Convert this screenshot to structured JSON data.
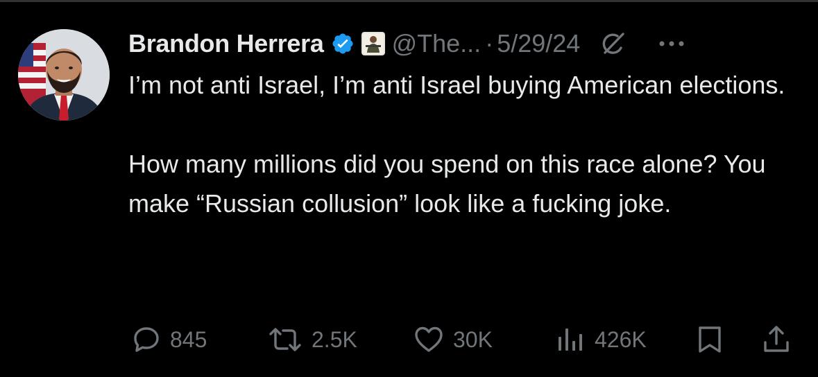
{
  "tweet": {
    "author": {
      "name": "Brandon Herrera",
      "handle": "@The...",
      "verified": true,
      "verified_color": "#1d9bf0"
    },
    "separator": "·",
    "date": "5/29/24",
    "text_paragraphs": [
      "I’m not anti Israel, I’m anti Israel buying American elections.",
      "How many millions did you spend on this race alone? You make “Russian collusion” look like a fucking joke."
    ],
    "actions": {
      "replies": "845",
      "reposts": "2.5K",
      "likes": "30K",
      "views": "426K"
    }
  },
  "icons": {
    "avatar": "avatar",
    "verified": "verified-badge-icon",
    "affiliate": "affiliate-badge-icon",
    "grok": "grok-icon",
    "more": "more-icon",
    "reply": "reply-icon",
    "repost": "repost-icon",
    "like": "like-icon",
    "views": "views-icon",
    "bookmark": "bookmark-icon",
    "share": "share-icon"
  },
  "colors": {
    "background": "#000000",
    "text": "#e7e9ea",
    "secondary": "#71767b",
    "accent": "#1d9bf0"
  }
}
